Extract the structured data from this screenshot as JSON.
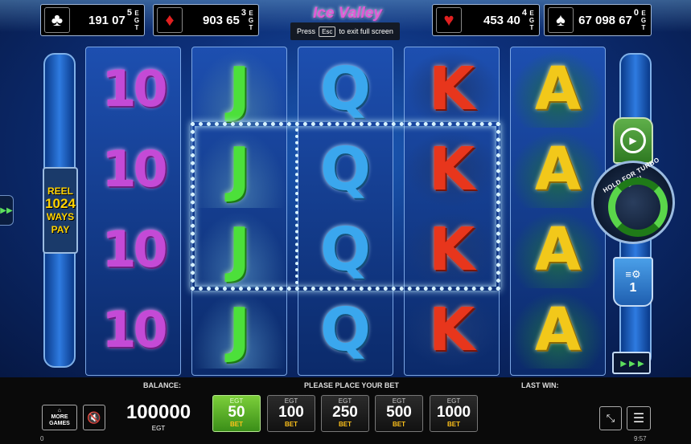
{
  "jackpots": [
    {
      "suit": "clubs",
      "glyph": "♣",
      "color": "#ffffff",
      "value": "191 07",
      "last": "5",
      "egt": [
        "E",
        "G",
        "T"
      ]
    },
    {
      "suit": "diamonds",
      "glyph": "♦",
      "color": "#e02020",
      "value": "903 65",
      "last": "3",
      "egt": [
        "E",
        "G",
        "T"
      ]
    },
    {
      "suit": "hearts",
      "glyph": "♥",
      "color": "#e02020",
      "value": "453 40",
      "last": "4",
      "egt": [
        "E",
        "G",
        "T"
      ]
    },
    {
      "suit": "spades",
      "glyph": "♠",
      "color": "#ffffff",
      "value": "67 098 67",
      "last": "0",
      "egt": [
        "E",
        "G",
        "T"
      ]
    }
  ],
  "game_logo": "Ice Valley",
  "fullscreen_notice": {
    "press": "Press",
    "key": "Esc",
    "rest": "to exit full screen"
  },
  "ways_badge": {
    "line1": "REEL",
    "line2": "1024",
    "line3": "WAYS",
    "line4": "PAY"
  },
  "reels": [
    [
      "10",
      "10",
      "10",
      "10"
    ],
    [
      "J",
      "J",
      "J",
      "J"
    ],
    [
      "Q",
      "Q",
      "Q",
      "Q"
    ],
    [
      "K",
      "K",
      "K",
      "K"
    ],
    [
      "A",
      "A",
      "A",
      "A"
    ]
  ],
  "spin": {
    "turbo_label": "HOLD FOR TURBO SPIN"
  },
  "lines": {
    "icon": "≡⚙",
    "value": "1"
  },
  "skip_icon": "►►►",
  "labels": {
    "balance": "BALANCE:",
    "place_bet": "PLEASE PLACE YOUR BET",
    "last_win": "LAST WIN:"
  },
  "more_games": {
    "line1": "⌂",
    "line2": "MORE",
    "line3": "GAMES"
  },
  "sound_icon": "🔇",
  "balance": {
    "value": "100000",
    "currency": "EGT"
  },
  "bets": [
    {
      "top": "EGT",
      "value": "50",
      "label": "BET",
      "active": true
    },
    {
      "top": "EGT",
      "value": "100",
      "label": "BET",
      "active": false
    },
    {
      "top": "EGT",
      "value": "250",
      "label": "BET",
      "active": false
    },
    {
      "top": "EGT",
      "value": "500",
      "label": "BET",
      "active": false
    },
    {
      "top": "EGT",
      "value": "1000",
      "label": "BET",
      "active": false
    }
  ],
  "collapse_icon": "⤡",
  "menu_icon": "☰",
  "footer": {
    "left": "0",
    "right": "9:57"
  }
}
